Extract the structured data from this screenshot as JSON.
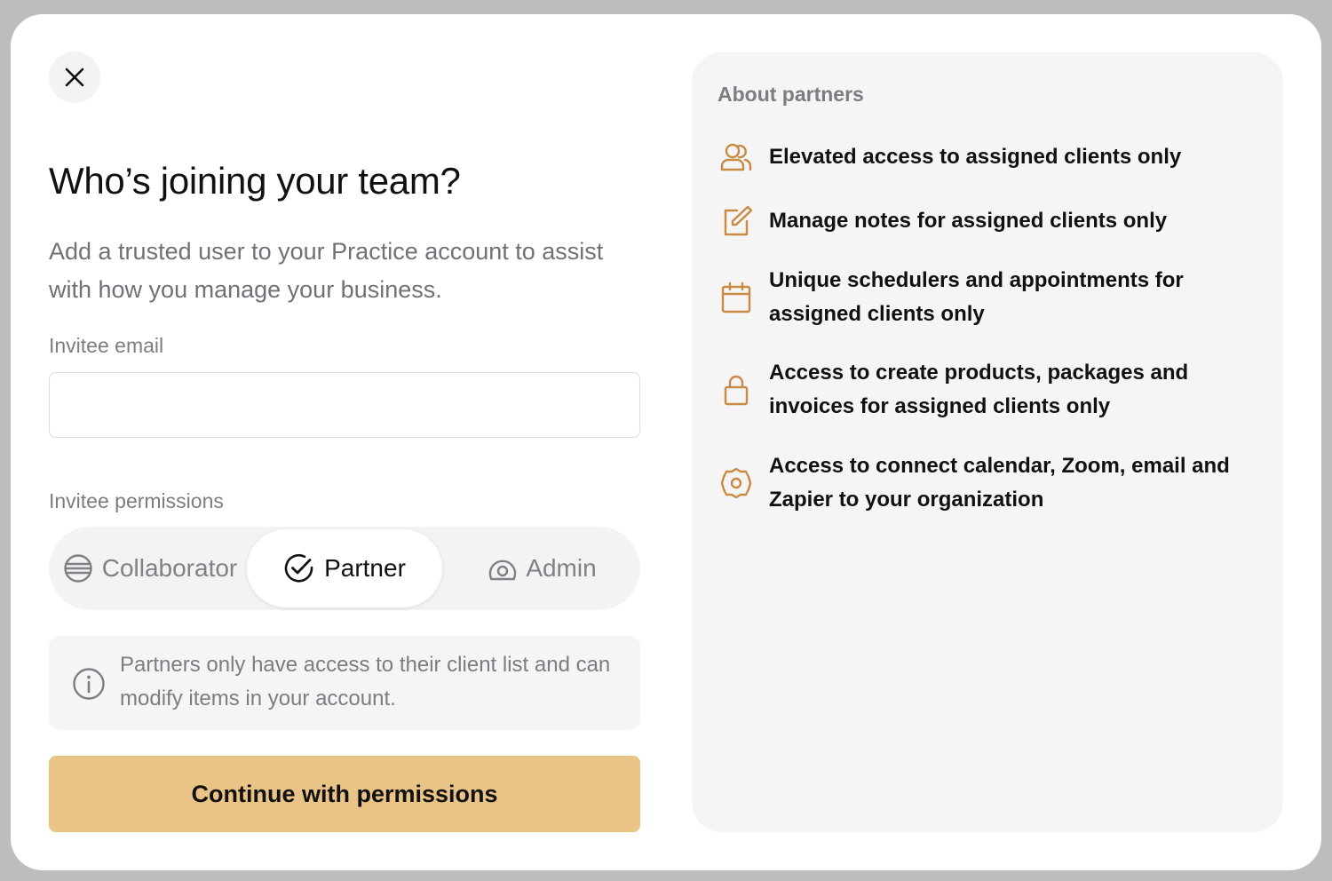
{
  "modal": {
    "close_icon": "close-icon",
    "title": "Who’s joining your team?",
    "subtitle": "Add a trusted user to your Practice account to assist with how you manage your business.",
    "email": {
      "label": "Invitee email",
      "value": "",
      "placeholder": ""
    },
    "permissions": {
      "label": "Invitee permissions",
      "options": [
        {
          "label": "Collaborator",
          "icon": "globe-icon",
          "selected": false
        },
        {
          "label": "Partner",
          "icon": "check-circle-icon",
          "selected": true
        },
        {
          "label": "Admin",
          "icon": "user-circle-icon",
          "selected": false
        }
      ]
    },
    "info": {
      "icon": "info-icon",
      "text": "Partners only have access to their client list and can modify items in your account."
    },
    "cta_label": "Continue with permissions"
  },
  "panel": {
    "title": "About partners",
    "features": [
      {
        "icon": "users-icon",
        "text": "Elevated access to assigned clients only"
      },
      {
        "icon": "edit-note-icon",
        "text": "Manage notes for assigned clients only"
      },
      {
        "icon": "calendar-icon",
        "text": "Unique schedulers and appointments for assigned clients only"
      },
      {
        "icon": "lock-icon",
        "text": "Access to create products, packages and invoices for assigned clients only"
      },
      {
        "icon": "settings-icon",
        "text": "Access to connect calendar, Zoom, email and Zapier to your organization"
      }
    ]
  },
  "colors": {
    "accent": "#e9c486",
    "icon_accent": "#c98a44",
    "muted_text": "#7b7d83",
    "panel_bg": "#f5f5f5",
    "backdrop": "#bdbdbd"
  }
}
